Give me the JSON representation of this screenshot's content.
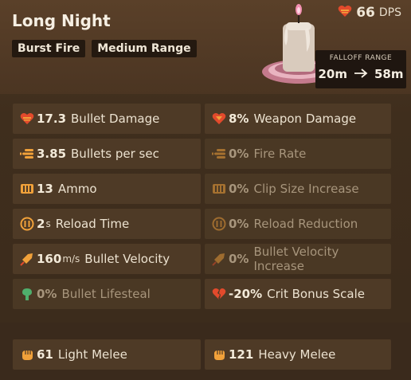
{
  "weapon": {
    "name": "Long Night",
    "tags": [
      "Burst Fire",
      "Medium Range"
    ],
    "dps_value": "66",
    "dps_unit": "DPS",
    "falloff_label": "FALLOFF RANGE",
    "falloff_min": "20m",
    "falloff_max": "58m"
  },
  "stats": [
    {
      "icon": "heart-bullet-icon",
      "value": "17.3",
      "unit": "",
      "label": "Bullet Damage",
      "dim": false
    },
    {
      "icon": "heart-down-icon",
      "value": "8%",
      "unit": "",
      "label": "Weapon Damage",
      "dim": false
    },
    {
      "icon": "fire-rate-icon",
      "value": "3.85",
      "unit": "",
      "label": "Bullets per sec",
      "dim": false
    },
    {
      "icon": "fire-rate-icon",
      "value": "0%",
      "unit": "",
      "label": "Fire Rate",
      "dim": true
    },
    {
      "icon": "ammo-icon",
      "value": "13",
      "unit": "",
      "label": "Ammo",
      "dim": false
    },
    {
      "icon": "ammo-icon",
      "value": "0%",
      "unit": "",
      "label": "Clip Size Increase",
      "dim": true
    },
    {
      "icon": "reload-icon",
      "value": "2",
      "unit": "s",
      "label": "Reload Time",
      "dim": false
    },
    {
      "icon": "reload-icon",
      "value": "0%",
      "unit": "",
      "label": "Reload Reduction",
      "dim": true
    },
    {
      "icon": "bullet-velocity-icon",
      "value": "160",
      "unit": "m/s",
      "label": "Bullet Velocity",
      "dim": false
    },
    {
      "icon": "bullet-velocity-icon",
      "value": "0%",
      "unit": "",
      "label": "Bullet Velocity Increase",
      "dim": true
    },
    {
      "icon": "lifesteal-icon",
      "value": "0%",
      "unit": "",
      "label": "Bullet Lifesteal",
      "dim": true
    },
    {
      "icon": "broken-heart-icon",
      "value": "-20%",
      "unit": "",
      "label": "Crit Bonus Scale",
      "dim": false
    }
  ],
  "melee": [
    {
      "icon": "fist-icon",
      "value": "61",
      "label": "Light Melee"
    },
    {
      "icon": "fist-icon",
      "value": "121",
      "label": "Heavy Melee"
    }
  ],
  "colors": {
    "accent_orange": "#f1a13a",
    "damage_red": "#e24a2c",
    "lifesteal_green": "#4fae6c"
  }
}
